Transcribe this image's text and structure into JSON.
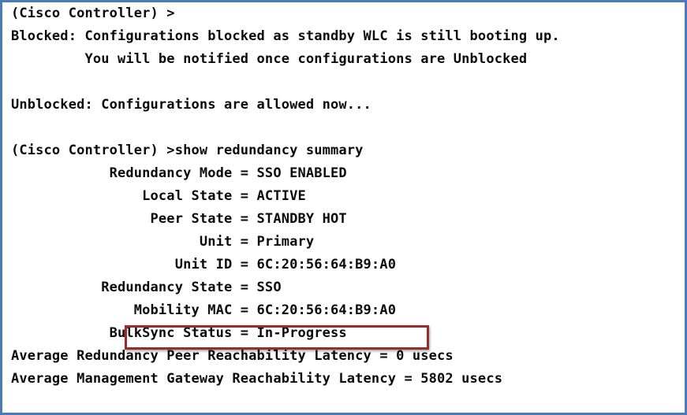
{
  "terminal": {
    "lines": [
      "(Cisco Controller) >",
      "Blocked: Configurations blocked as standby WLC is still booting up.",
      "         You will be notified once configurations are Unblocked",
      "",
      "Unblocked: Configurations are allowed now...",
      "",
      "(Cisco Controller) >show redundancy summary",
      "            Redundancy Mode = SSO ENABLED",
      "                Local State = ACTIVE",
      "                 Peer State = STANDBY HOT",
      "                       Unit = Primary",
      "                    Unit ID = 6C:20:56:64:B9:A0",
      "           Redundancy State = SSO",
      "               Mobility MAC = 6C:20:56:64:B9:A0",
      "            BulkSync Status = In-Progress",
      "Average Redundancy Peer Reachability Latency = 0 usecs",
      "Average Management Gateway Reachability Latency = 5802 usecs"
    ]
  },
  "colors": {
    "border": "#4a7ab8",
    "highlight": "#9b2c2c",
    "text": "#0a0a0a"
  }
}
